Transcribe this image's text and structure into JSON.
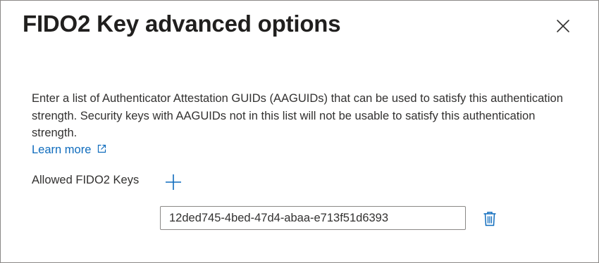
{
  "dialog": {
    "title": "FIDO2 Key advanced options",
    "close_icon": "close-icon",
    "description": "Enter a list of Authenticator Attestation GUIDs (AAGUIDs) that can be used to satisfy this authentication strength. Security keys with AAGUIDs not in this list will not be usable to satisfy this authentication strength.",
    "learn_more": {
      "label": "Learn more",
      "icon": "external-link-icon"
    },
    "allowed_keys": {
      "label": "Allowed FIDO2 Keys",
      "add_icon": "add-icon",
      "keys": [
        {
          "value": "12ded745-4bed-47d4-abaa-e713f51d6393",
          "delete_icon": "delete-icon"
        }
      ]
    }
  },
  "colors": {
    "link": "#0f6cbd",
    "text": "#323130",
    "border": "#8a8886"
  }
}
